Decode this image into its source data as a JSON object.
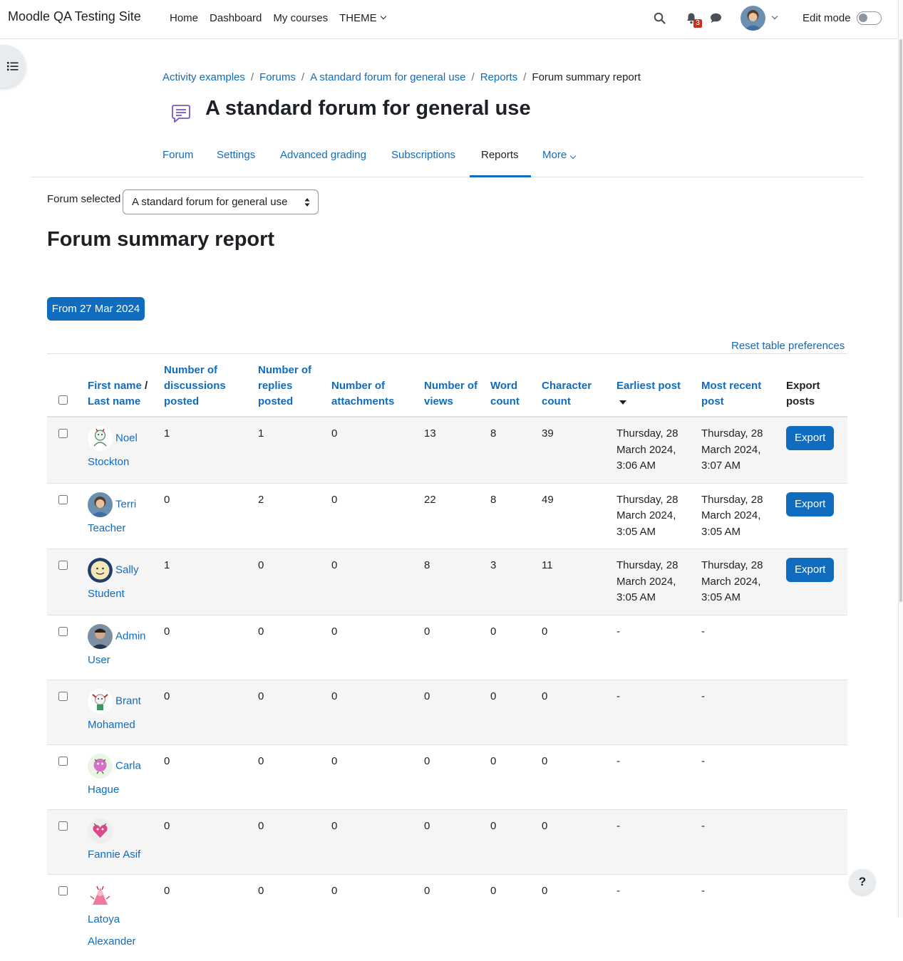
{
  "site": {
    "name": "Moodle QA Testing Site"
  },
  "primary_nav": [
    "Home",
    "Dashboard",
    "My courses",
    "THEME"
  ],
  "notifications": {
    "count": "3"
  },
  "edit_mode": {
    "label": "Edit mode"
  },
  "breadcrumb": [
    "Activity examples",
    "Forums",
    "A standard forum for general use",
    "Reports",
    "Forum summary report"
  ],
  "page": {
    "title": "A standard forum for general use"
  },
  "tabs": [
    "Forum",
    "Settings",
    "Advanced grading",
    "Subscriptions",
    "Reports",
    "More"
  ],
  "active_tab": "Reports",
  "forum_select": {
    "label": "Forum selected",
    "value": "A standard forum for general use"
  },
  "report": {
    "title": "Forum summary report",
    "date_filter": "From 27 Mar 2024",
    "reset_link": "Reset table preferences"
  },
  "table": {
    "headers": {
      "first_name": "First name",
      "slash": " / ",
      "last_name": "Last name",
      "discussions": "Number of discussions posted",
      "replies": "Number of replies posted",
      "attachments": "Number of attachments",
      "views": "Number of views",
      "words": "Word count",
      "chars": "Character count",
      "earliest": "Earliest post",
      "recent": "Most recent post",
      "export": "Export posts"
    },
    "rows": [
      {
        "name": "Noel Stockton",
        "first": "Noel",
        "last": "Stockton",
        "discussions": "1",
        "replies": "1",
        "attachments": "0",
        "views": "13",
        "words": "8",
        "chars": "39",
        "earliest": "Thursday, 28 March 2024, 3:06 AM",
        "recent": "Thursday, 28 March 2024, 3:07 AM",
        "export": "Export"
      },
      {
        "name": "Terri Teacher",
        "first": "Terri",
        "last": "Teacher",
        "discussions": "0",
        "replies": "2",
        "attachments": "0",
        "views": "22",
        "words": "8",
        "chars": "49",
        "earliest": "Thursday, 28 March 2024, 3:05 AM",
        "recent": "Thursday, 28 March 2024, 3:05 AM",
        "export": "Export"
      },
      {
        "name": "Sally Student",
        "first": "Sally",
        "last": "Student",
        "discussions": "1",
        "replies": "0",
        "attachments": "0",
        "views": "8",
        "words": "3",
        "chars": "11",
        "earliest": "Thursday, 28 March 2024, 3:05 AM",
        "recent": "Thursday, 28 March 2024, 3:05 AM",
        "export": "Export"
      },
      {
        "name": "Admin User",
        "first": "Admin",
        "last": "User",
        "discussions": "0",
        "replies": "0",
        "attachments": "0",
        "views": "0",
        "words": "0",
        "chars": "0",
        "earliest": "-",
        "recent": "-",
        "export": ""
      },
      {
        "name": "Brant Mohamed",
        "first": "Brant",
        "last": "Mohamed",
        "discussions": "0",
        "replies": "0",
        "attachments": "0",
        "views": "0",
        "words": "0",
        "chars": "0",
        "earliest": "-",
        "recent": "-",
        "export": ""
      },
      {
        "name": "Carla Hague",
        "first": "Carla",
        "last": "Hague",
        "discussions": "0",
        "replies": "0",
        "attachments": "0",
        "views": "0",
        "words": "0",
        "chars": "0",
        "earliest": "-",
        "recent": "-",
        "export": ""
      },
      {
        "name": "Fannie Asif",
        "first": "",
        "last": "Fannie Asif",
        "discussions": "0",
        "replies": "0",
        "attachments": "0",
        "views": "0",
        "words": "0",
        "chars": "0",
        "earliest": "-",
        "recent": "-",
        "export": ""
      },
      {
        "name": "Latoya Alexander",
        "first": "",
        "last": "Latoya Alexander",
        "discussions": "0",
        "replies": "0",
        "attachments": "0",
        "views": "0",
        "words": "0",
        "chars": "0",
        "earliest": "-",
        "recent": "-",
        "export": ""
      }
    ]
  },
  "help": {
    "label": "?"
  },
  "colors": {
    "link": "#0f6cbf",
    "badge": "#ca3120",
    "stripe": "#f5f5f5"
  }
}
